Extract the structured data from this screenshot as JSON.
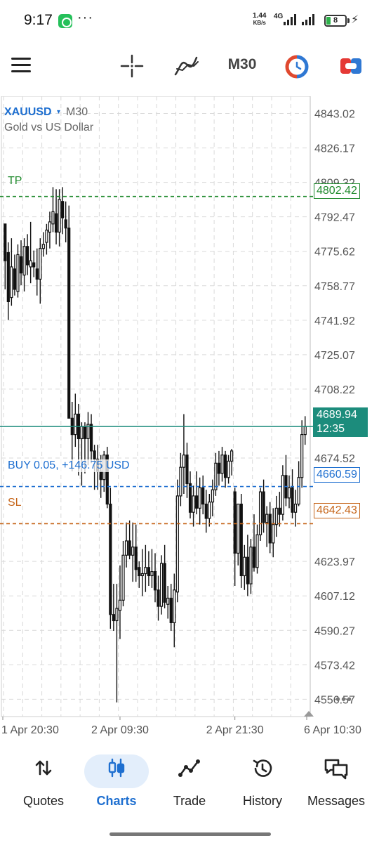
{
  "status_bar": {
    "time": "9:17",
    "more": "···",
    "net_speed_value": "1.44",
    "net_speed_unit": "KB/s",
    "network": "4G",
    "battery": "8",
    "charging_icon": "lightning-icon"
  },
  "toolbar": {
    "icons": [
      "menu-icon",
      "crosshair-icon",
      "indicator-icon",
      "one-click-trading-icon",
      "trade-panel-icon"
    ],
    "timeframe": "M30"
  },
  "chart": {
    "symbol": "XAUUSD",
    "symbol_caret": "▾",
    "symbol_timeframe": "M30",
    "symbol_description": "Gold vs US Dollar",
    "tp_label": "TP",
    "sl_label": "SL",
    "position_label": "BUY 0.05, +146.75 USD",
    "tp_price": "4802.42",
    "position_price": "4660.59",
    "sl_price": "4642.43",
    "bid_price": "4689.94",
    "bar_countdown": "12:35",
    "more": "•••",
    "colors": {
      "tp": "#1f8a2c",
      "sl": "#c66519",
      "position": "#1e6fd0",
      "bid": "#1c8c7c",
      "candle": "#111111",
      "grid": "#d9d9d9"
    }
  },
  "chart_data": {
    "type": "candlestick",
    "ylim": [
      4548.1,
      4851.45
    ],
    "y_ticks": [
      "4843.02",
      "4826.17",
      "4809.32",
      "4792.47",
      "4775.62",
      "4758.77",
      "4741.92",
      "4725.07",
      "4708.22",
      "4674.52",
      "4623.97",
      "4607.12",
      "4590.27",
      "4573.42",
      "4556.57"
    ],
    "x_ticks": [
      "1 Apr 20:30",
      "2 Apr 09:30",
      "2 Apr 21:30",
      "6 Apr 10:30"
    ],
    "levels": {
      "tp": 4802.42,
      "position": 4660.59,
      "sl": 4642.43,
      "bid": 4689.94
    },
    "candles": [
      [
        4789,
        4789,
        4757,
        4771
      ],
      [
        4775,
        4780,
        4742,
        4751
      ],
      [
        4753,
        4782,
        4749,
        4768
      ],
      [
        4767,
        4774,
        4754,
        4757
      ],
      [
        4756,
        4779,
        4753,
        4774
      ],
      [
        4773,
        4781,
        4759,
        4765
      ],
      [
        4764,
        4782,
        4756,
        4778
      ],
      [
        4778,
        4784,
        4764,
        4769
      ],
      [
        4768,
        4790,
        4760,
        4771
      ],
      [
        4770,
        4776,
        4763,
        4768
      ],
      [
        4767,
        4777,
        4754,
        4762
      ],
      [
        4762,
        4782,
        4750,
        4777
      ],
      [
        4777,
        4785,
        4773,
        4779
      ],
      [
        4780,
        4789,
        4774,
        4786
      ],
      [
        4785,
        4795,
        4777,
        4790
      ],
      [
        4789,
        4807,
        4785,
        4795
      ],
      [
        4794,
        4806,
        4779,
        4785
      ],
      [
        4785,
        4806,
        4778,
        4801
      ],
      [
        4800,
        4807,
        4784,
        4792
      ],
      [
        4791,
        4800,
        4780,
        4787
      ],
      [
        4787,
        4798,
        4694,
        4694
      ],
      [
        4694,
        4702,
        4668,
        4686
      ],
      [
        4686,
        4706,
        4680,
        4696
      ],
      [
        4696,
        4701,
        4666,
        4684
      ],
      [
        4684,
        4692,
        4661,
        4690
      ],
      [
        4690,
        4692,
        4667,
        4684
      ],
      [
        4684,
        4697,
        4671,
        4691
      ],
      [
        4691,
        4696,
        4672,
        4678
      ],
      [
        4678,
        4681,
        4659,
        4674
      ],
      [
        4674,
        4681,
        4659,
        4668
      ],
      [
        4668,
        4676,
        4655,
        4664
      ],
      [
        4664,
        4678,
        4658,
        4676
      ],
      [
        4676,
        4680,
        4650,
        4652
      ],
      [
        4652,
        4660,
        4591,
        4598
      ],
      [
        4598,
        4613,
        4590,
        4595
      ],
      [
        4595,
        4613,
        4555,
        4601
      ],
      [
        4600,
        4622,
        4586,
        4605
      ],
      [
        4605,
        4634,
        4602,
        4627
      ],
      [
        4627,
        4643,
        4621,
        4634
      ],
      [
        4634,
        4644,
        4625,
        4627
      ],
      [
        4627,
        4643,
        4614,
        4631
      ],
      [
        4631,
        4642,
        4614,
        4620
      ],
      [
        4621,
        4624,
        4611,
        4617
      ],
      [
        4617,
        4630,
        4607,
        4618
      ],
      [
        4618,
        4632,
        4609,
        4621
      ],
      [
        4621,
        4629,
        4612,
        4617
      ],
      [
        4617,
        4630,
        4611,
        4619
      ],
      [
        4619,
        4628,
        4604,
        4610
      ],
      [
        4610,
        4617,
        4595,
        4602
      ],
      [
        4602,
        4627,
        4598,
        4623
      ],
      [
        4623,
        4632,
        4601,
        4604
      ],
      [
        4603,
        4612,
        4596,
        4606
      ],
      [
        4606,
        4613,
        4590,
        4594
      ],
      [
        4594,
        4618,
        4582,
        4610
      ],
      [
        4609,
        4664,
        4604,
        4656
      ],
      [
        4656,
        4677,
        4651,
        4670
      ],
      [
        4670,
        4696,
        4657,
        4676
      ],
      [
        4676,
        4682,
        4655,
        4662
      ],
      [
        4662,
        4668,
        4645,
        4648
      ],
      [
        4648,
        4661,
        4641,
        4656
      ],
      [
        4656,
        4668,
        4647,
        4650
      ],
      [
        4650,
        4665,
        4642,
        4660
      ],
      [
        4660,
        4666,
        4647,
        4652
      ],
      [
        4652,
        4659,
        4638,
        4645
      ],
      [
        4645,
        4657,
        4641,
        4653
      ],
      [
        4653,
        4664,
        4646,
        4659
      ],
      [
        4659,
        4677,
        4656,
        4672
      ],
      [
        4672,
        4678,
        4661,
        4667
      ],
      [
        4667,
        4680,
        4663,
        4676
      ],
      [
        4676,
        4678,
        4660,
        4665
      ],
      [
        4665,
        4676,
        4662,
        4673
      ],
      [
        4673,
        4679,
        4666,
        4678
      ],
      [
        4658,
        4660,
        4612,
        4628
      ],
      [
        4628,
        4652,
        4622,
        4652
      ],
      [
        4652,
        4657,
        4611,
        4617
      ],
      [
        4617,
        4632,
        4610,
        4626
      ],
      [
        4626,
        4637,
        4607,
        4613
      ],
      [
        4613,
        4635,
        4608,
        4631
      ],
      [
        4631,
        4647,
        4619,
        4621
      ],
      [
        4621,
        4642,
        4618,
        4637
      ],
      [
        4637,
        4660,
        4634,
        4658
      ],
      [
        4658,
        4664,
        4638,
        4643
      ],
      [
        4643,
        4651,
        4631,
        4647
      ],
      [
        4647,
        4653,
        4628,
        4633
      ],
      [
        4633,
        4650,
        4626,
        4642
      ],
      [
        4642,
        4656,
        4636,
        4650
      ],
      [
        4650,
        4658,
        4641,
        4647
      ],
      [
        4647,
        4671,
        4644,
        4666
      ],
      [
        4666,
        4676,
        4651,
        4655
      ],
      [
        4655,
        4666,
        4650,
        4660
      ],
      [
        4660,
        4669,
        4645,
        4648
      ],
      [
        4648,
        4659,
        4641,
        4652
      ],
      [
        4652,
        4673,
        4651,
        4665
      ],
      [
        4665,
        4693,
        4660,
        4686
      ],
      [
        4686,
        4695,
        4681,
        4690
      ]
    ]
  },
  "bottom_nav": {
    "items": [
      {
        "label": "Quotes",
        "icon": "sort-arrows-icon"
      },
      {
        "label": "Charts",
        "icon": "candlestick-icon"
      },
      {
        "label": "Trade",
        "icon": "trend-line-icon"
      },
      {
        "label": "History",
        "icon": "history-clock-icon"
      },
      {
        "label": "Messages",
        "icon": "chat-bubbles-icon"
      }
    ]
  }
}
